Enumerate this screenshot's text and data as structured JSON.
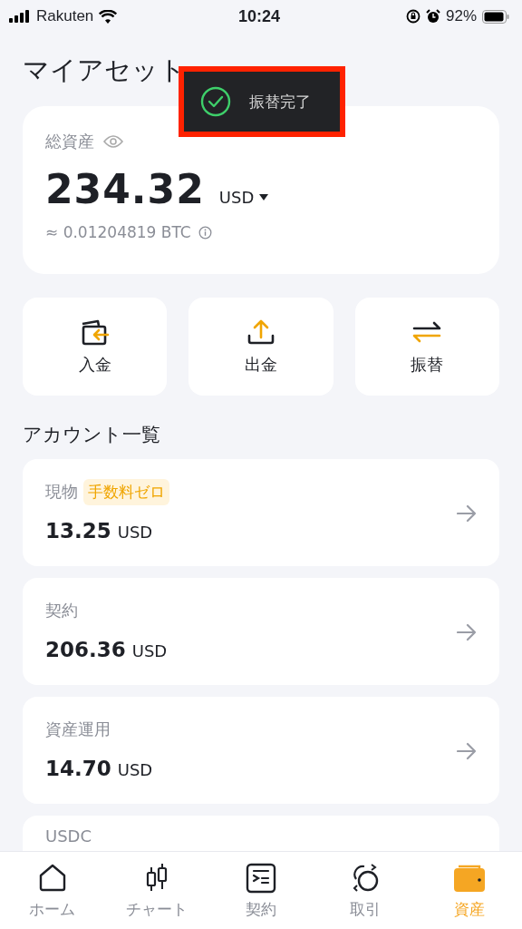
{
  "status_bar": {
    "carrier": "Rakuten",
    "time": "10:24",
    "battery": "92%"
  },
  "title": "マイアセット",
  "toast": {
    "message": "振替完了"
  },
  "total": {
    "label": "総資産",
    "amount": "234.32",
    "currency": "USD",
    "btc": "≈ 0.01204819 BTC"
  },
  "actions": [
    {
      "label": "入金",
      "kind": "deposit"
    },
    {
      "label": "出金",
      "kind": "withdraw"
    },
    {
      "label": "振替",
      "kind": "transfer"
    }
  ],
  "accounts_heading": "アカウント一覧",
  "accounts": [
    {
      "name": "現物",
      "badge": "手数料ゼロ",
      "amount": "13.25",
      "currency": "USD"
    },
    {
      "name": "契約",
      "amount": "206.36",
      "currency": "USD"
    },
    {
      "name": "資産運用",
      "amount": "14.70",
      "currency": "USD"
    },
    {
      "name": "USDC"
    }
  ],
  "tabs": [
    {
      "label": "ホーム",
      "kind": "home",
      "selected": false
    },
    {
      "label": "チャート",
      "kind": "chart",
      "selected": false
    },
    {
      "label": "契約",
      "kind": "contract",
      "selected": false
    },
    {
      "label": "取引",
      "kind": "trade",
      "selected": false
    },
    {
      "label": "資産",
      "kind": "wallet",
      "selected": true
    }
  ]
}
